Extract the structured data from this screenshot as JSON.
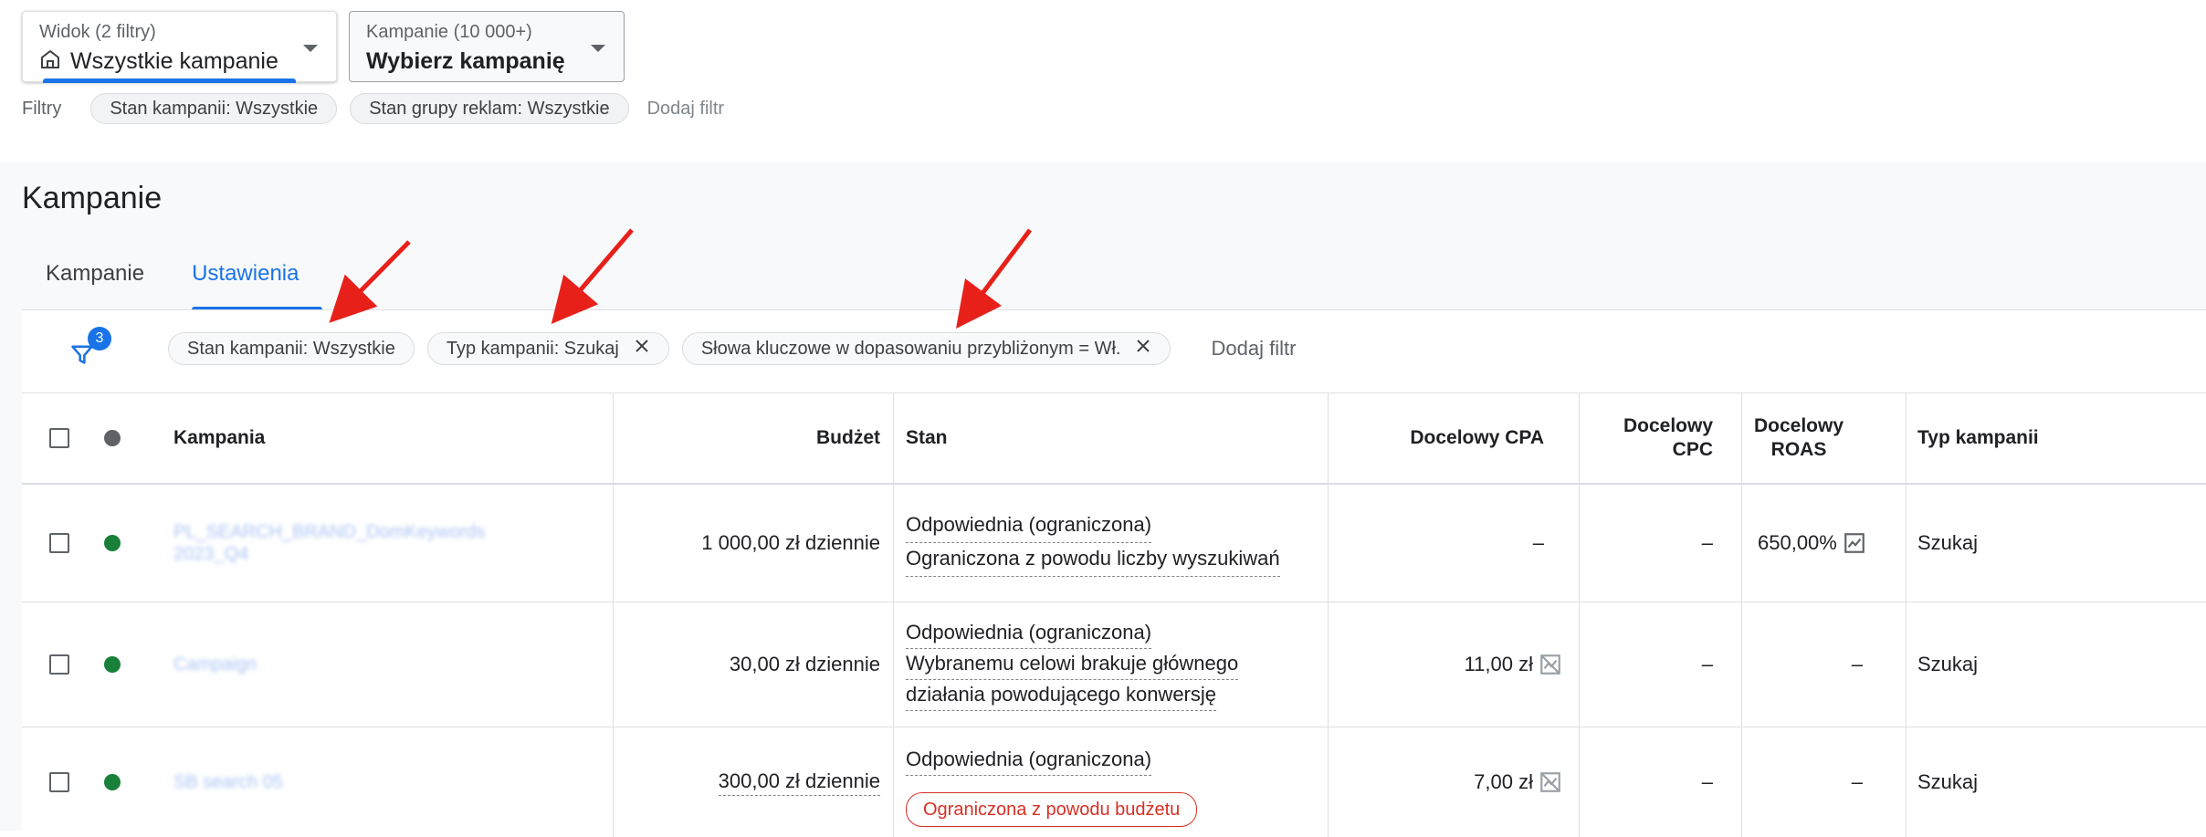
{
  "view_selector": {
    "label": "Widok (2 filtry)",
    "value": "Wszystkie kampanie"
  },
  "campaign_selector": {
    "label": "Kampanie (10 000+)",
    "value": "Wybierz kampanię"
  },
  "top_filters": {
    "label": "Filtry",
    "chips": [
      "Stan kampanii: Wszystkie",
      "Stan grupy reklam: Wszystkie"
    ],
    "add": "Dodaj filtr"
  },
  "page_title": "Kampanie",
  "tabs": [
    {
      "label": "Kampanie"
    },
    {
      "label": "Ustawienia",
      "active": true
    }
  ],
  "filter_bar": {
    "badge": "3",
    "chips": [
      {
        "label": "Stan kampanii: Wszystkie",
        "removable": false
      },
      {
        "label": "Typ kampanii: Szukaj",
        "removable": true
      },
      {
        "label": "Słowa kluczowe w dopasowaniu przybliżonym = Wł.",
        "removable": true
      }
    ],
    "add": "Dodaj filtr"
  },
  "table": {
    "headers": {
      "campaign": "Kampania",
      "budget": "Budżet",
      "status": "Stan",
      "target_cpa": "Docelowy CPA",
      "target_cpc": [
        "Docelowy",
        "CPC"
      ],
      "target_roas": [
        "Docelowy",
        "ROAS"
      ],
      "type": "Typ kampanii"
    },
    "rows": [
      {
        "campaign": [
          "PL_SEARCH_BRAND_DomKeywords",
          "2023_Q4"
        ],
        "budget": "1 000,00 zł dziennie",
        "status": [
          "Odpowiednia (ograniczona)",
          "Ograniczona z powodu liczby wyszukiwań"
        ],
        "target_cpa": "–",
        "target_cpc": "–",
        "target_roas": "650,00%",
        "type": "Szukaj"
      },
      {
        "campaign": [
          "Campaign"
        ],
        "budget": "30,00 zł dziennie",
        "status": [
          "Odpowiednia (ograniczona)",
          "Wybranemu celowi brakuje głównego",
          "działania powodującego konwersję"
        ],
        "target_cpa": "11,00 zł",
        "target_cpc": "–",
        "target_roas": "–",
        "type": "Szukaj"
      },
      {
        "campaign": [
          "SB search 05"
        ],
        "budget": "300,00 zł dziennie",
        "status": [
          "Odpowiednia (ograniczona)"
        ],
        "status_pill": "Ograniczona z powodu budżetu",
        "target_cpa": "7,00 zł",
        "target_cpc": "–",
        "target_roas": "–",
        "type": "Szukaj"
      }
    ]
  },
  "colors": {
    "accent": "#1a73e8",
    "enabled_dot": "#188038",
    "header_dot": "#5f6368",
    "limited_red": "#d93025",
    "annotation_arrow": "#e8201a"
  }
}
